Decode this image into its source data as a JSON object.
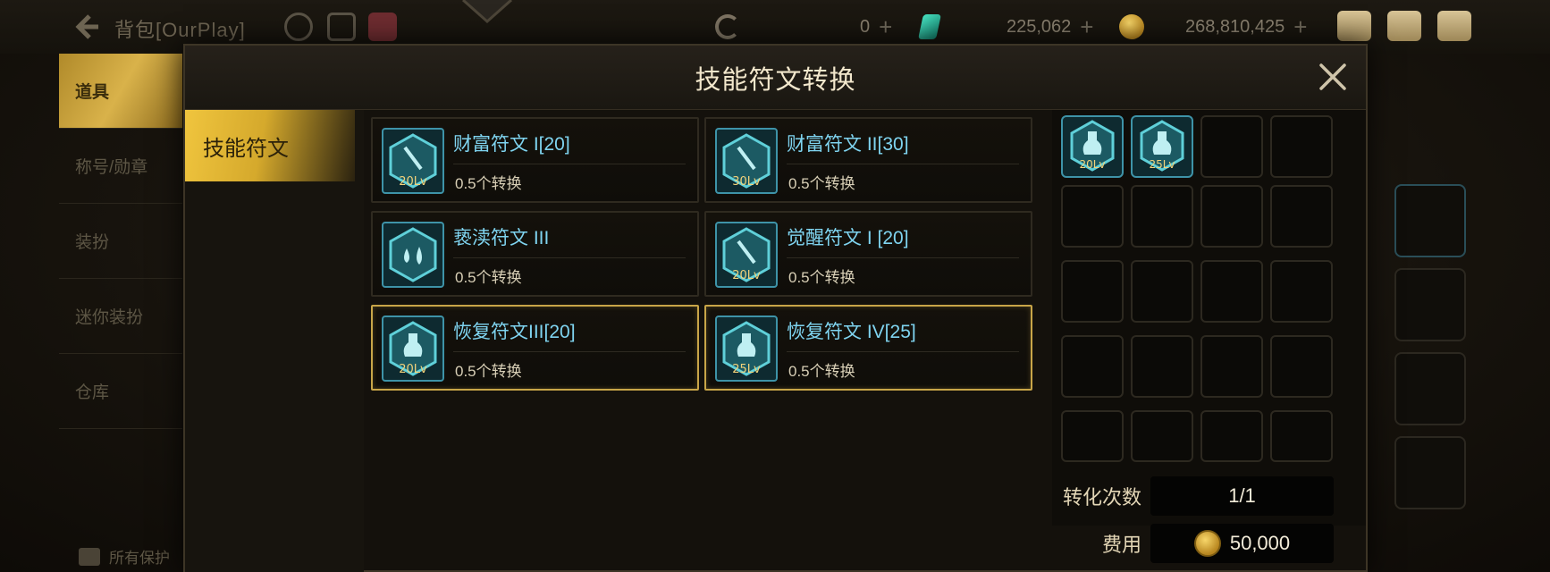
{
  "topbar": {
    "back_title": "背包[OurPlay]",
    "currencies": [
      {
        "icon": "moon-icon",
        "value": "0"
      },
      {
        "icon": "gem-icon",
        "value": "225,062"
      },
      {
        "icon": "coin-icon",
        "value": "268,810,425"
      }
    ],
    "plus": "+"
  },
  "background_menu": {
    "items": [
      "道具",
      "称号/勋章",
      "装扮",
      "迷你装扮",
      "仓库"
    ],
    "footer": "所有保护"
  },
  "modal": {
    "title": "技能符文转换",
    "tabs": [
      {
        "label": "技能符文"
      }
    ],
    "runes": [
      {
        "name": "财富符文 I[20]",
        "rate": "0.5个转换",
        "level": "20Lv",
        "icon": "sword-rune-icon",
        "selected": false
      },
      {
        "name": "财富符文 II[30]",
        "rate": "0.5个转换",
        "level": "30Lv",
        "icon": "sword-rune-icon",
        "selected": false
      },
      {
        "name": "亵渎符文 III",
        "rate": "0.5个转换",
        "level": "",
        "icon": "drops-rune-icon",
        "selected": false
      },
      {
        "name": "觉醒符文 I [20]",
        "rate": "0.5个转换",
        "level": "20Lv",
        "icon": "sword-rune-icon",
        "selected": false
      },
      {
        "name": "恢复符文III[20]",
        "rate": "0.5个转换",
        "level": "20Lv",
        "icon": "potion-rune-icon",
        "selected": true
      },
      {
        "name": "恢复符文 IV[25]",
        "rate": "0.5个转换",
        "level": "25Lv",
        "icon": "potion-rune-icon",
        "selected": true
      }
    ],
    "slots": [
      {
        "level": "20Lv"
      },
      {
        "level": "25Lv"
      }
    ],
    "conversion_label": "转化次数",
    "conversion_value": "1/1",
    "fee_label": "费用",
    "fee_value": "50,000"
  },
  "colors": {
    "accent_gold": "#d5a92c",
    "rune_name": "#7fd4f0",
    "rune_border": "#3e93a8",
    "selected_border": "#c8a548"
  }
}
